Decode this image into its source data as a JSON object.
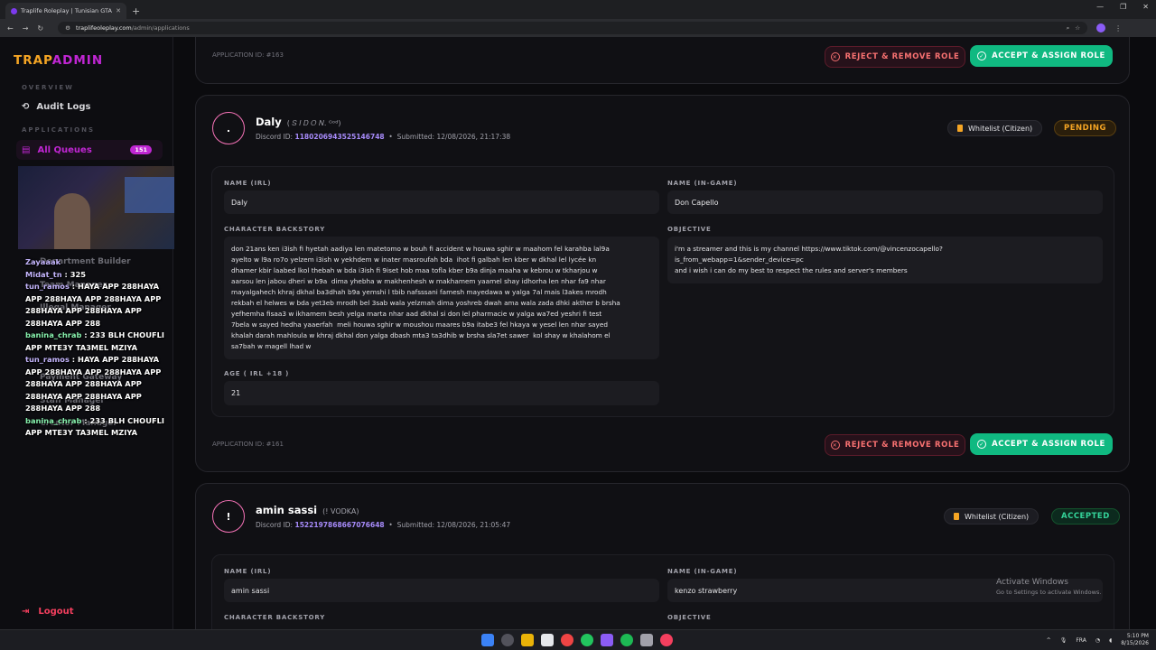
{
  "browser": {
    "tab_title": "Traplife Roleplay | Tunisian GTA",
    "url_host": "traplifeoleplay.com",
    "url_path": "/admin/applications"
  },
  "brand": {
    "part1": "TRAP",
    "part2": "ADMIN"
  },
  "sidebar": {
    "overview_label": "OVERVIEW",
    "audit_logs": "Audit Logs",
    "applications_label": "APPLICATIONS",
    "all_queues": "All Queues",
    "all_queues_count": "151",
    "logout": "Logout"
  },
  "stream_overlay": {
    "ghost_items": [
      "Department Builder",
      "Team Manager",
      "Illegal Manager",
      "Payment Gateway",
      "Staff Manager",
      "Creator Manager"
    ],
    "chat": [
      {
        "user": "Zayaaak",
        "msg": ""
      },
      {
        "user": "Midat_tn",
        "msg": ": 325"
      },
      {
        "user": "tun_ramos",
        "msg": ": HAYA APP 288HAYA APP 288HAYA APP 288HAYA APP 288HAYA APP 288HAYA APP 288HAYA APP 288"
      },
      {
        "user": "banina_chrab",
        "msg": ": 233 BLH CHOUFLI APP MTE3Y TA3MEL MZIYA"
      },
      {
        "user": "tun_ramos",
        "msg": ": HAYA APP 288HAYA APP 288HAYA APP 288HAYA APP 288HAYA APP 288HAYA APP 288HAYA APP 288HAYA APP 288HAYA APP 288"
      },
      {
        "user": "banina_chrab",
        "msg": ": 233 BLH CHOUFLI APP MTE3Y TA3MEL MZIYA"
      }
    ]
  },
  "top_card": {
    "app_id": "APPLICATION ID: #163",
    "reject": "REJECT & REMOVE ROLE",
    "accept": "ACCEPT & ASSIGN ROLE"
  },
  "app1": {
    "avatar": ".",
    "name": "Daly",
    "alias": "( 𝑆 𝐼 𝐷 𝑂 𝑁. ᴳᵒᵈ)",
    "discord_label": "Discord ID:",
    "discord_id": "1180206943525146748",
    "submitted": "Submitted: 12/08/2026, 21:17:38",
    "type": "Whitelist (Citizen)",
    "status": "PENDING",
    "labels": {
      "name_irl": "NAME (IRL)",
      "name_ig": "NAME (IN-GAME)",
      "backstory": "CHARACTER BACKSTORY",
      "objective": "OBJECTIVE",
      "age": "AGE ( IRL +18 )"
    },
    "name_irl": "Daly",
    "name_ig": "Don Capello",
    "backstory": "don 21ans ken i3ish fi hyetah aadiya len matetomo w bouh fi accident w houwa sghir w maahom fel karahba lal9a\nayelto w l9a ro7o yelzem i3ish w yekhdem w inater masroufah bda  ihot fi galbah len kber w dkhal lel lycée kn\ndhamer kbir laabed lkol thebah w bda i3ish fi 9iset hob maa tofla kber b9a dinja maaha w kebrou w tkharjou w\naarsou len jabou dheri w b9a  dima yhebha w makhenhesh w makhamem yaamel shay idhorha len nhar fa9 nhar\nmayalgahech khraj dkhal ba3dhah b9a yemshi l tbib nafsssani famesh mayedawa w yalga 7al mais l3akes mrodh\nrekbah el helwes w bda yet3eb mrodh bel 3sab wala yelzmah dima yoshreb dwah ama wala zada dhki akther b brsha\nyefhemha fisaa3 w ikhamem besh yelga marta nhar aad dkhal si don lel pharmacie w yalga wa7ed yeshri fi test\n7bela w sayed hedha yaaerfah  meli houwa sghir w moushou maares b9a itabe3 fel hkaya w yesel len nhar sayed\nkhalah darah mahloula w khraj dkhal don yalga dbash mta3 ta3dhib w brsha sla7et sawer  kol shay w khalahom el\nsa7bah w magell lhad w",
    "objective": "i'm a streamer and this is my channel https://www.tiktok.com/@vincenzocapello?\nis_from_webapp=1&sender_device=pc\nand i wish i can do my best to respect the rules and server's members",
    "age": "21",
    "app_id": "APPLICATION ID: #161",
    "reject": "REJECT & REMOVE ROLE",
    "accept": "ACCEPT & ASSIGN ROLE"
  },
  "app2": {
    "avatar": "!",
    "name": "amin sassi",
    "alias": "(! VODKA)",
    "discord_label": "Discord ID:",
    "discord_id": "1522197868667076648",
    "submitted": "Submitted: 12/08/2026, 21:05:47",
    "type": "Whitelist (Citizen)",
    "status": "ACCEPTED",
    "labels": {
      "name_irl": "NAME (IRL)",
      "name_ig": "NAME (IN-GAME)",
      "backstory": "CHARACTER BACKSTORY",
      "objective": "OBJECTIVE"
    },
    "name_irl": "amin sassi",
    "name_ig": "kenzo strawberry"
  },
  "windows": {
    "activate_title": "Activate Windows",
    "activate_sub": "Go to Settings to activate Windows.",
    "lang": "FRA",
    "time": "5:10 PM",
    "date": "8/15/2026"
  },
  "colors": {
    "accent_gold": "#f5a524",
    "accent_magenta": "#c026d3",
    "accept_green": "#10b981",
    "reject_red": "#f87171"
  }
}
